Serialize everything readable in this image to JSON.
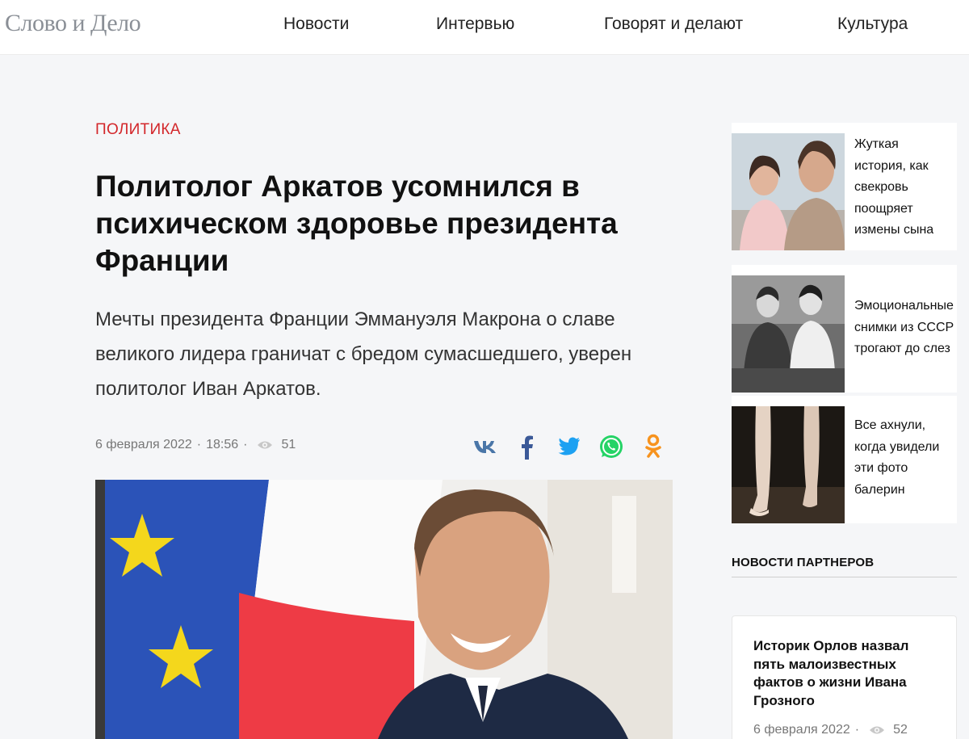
{
  "header": {
    "logo": "Слово и Дело",
    "nav": [
      "Новости",
      "Интервью",
      "Говорят и делают",
      "Культура"
    ]
  },
  "article": {
    "category": "ПОЛИТИКА",
    "title": "Политолог Аркатов усомнился в психическом здоровье президента Франции",
    "lead": "Мечты президента Франции Эммануэля Макрона о славе великого лидера граничат с бредом сумасшедшего, уверен политолог Иван Аркатов.",
    "date": "6 февраля 2022",
    "time": "18:56",
    "views": "51",
    "share": [
      {
        "name": "vk",
        "color": "#4a76a8"
      },
      {
        "name": "facebook",
        "color": "#3b5998"
      },
      {
        "name": "twitter",
        "color": "#1da1f2"
      },
      {
        "name": "whatsapp",
        "color": "#25d366"
      },
      {
        "name": "odnoklassniki",
        "color": "#f7931e"
      }
    ]
  },
  "sidebar": {
    "items": [
      {
        "lines": [
          "Жуткая",
          "история, как",
          "свекровь",
          "поощряет",
          "измены сына"
        ]
      },
      {
        "lines": [
          "Эмоциональные",
          "снимки из СССР",
          "трогают до слез"
        ]
      },
      {
        "lines": [
          "Все ахнули,",
          "когда увидели",
          "эти фото",
          "балерин"
        ]
      }
    ],
    "partners_heading": "НОВОСТИ ПАРТНЕРОВ",
    "partner": {
      "title": "Историк Орлов назвал пять малоизвестных фактов о жизни Ивана Грозного",
      "date": "6 февраля 2022",
      "views": "52"
    }
  }
}
